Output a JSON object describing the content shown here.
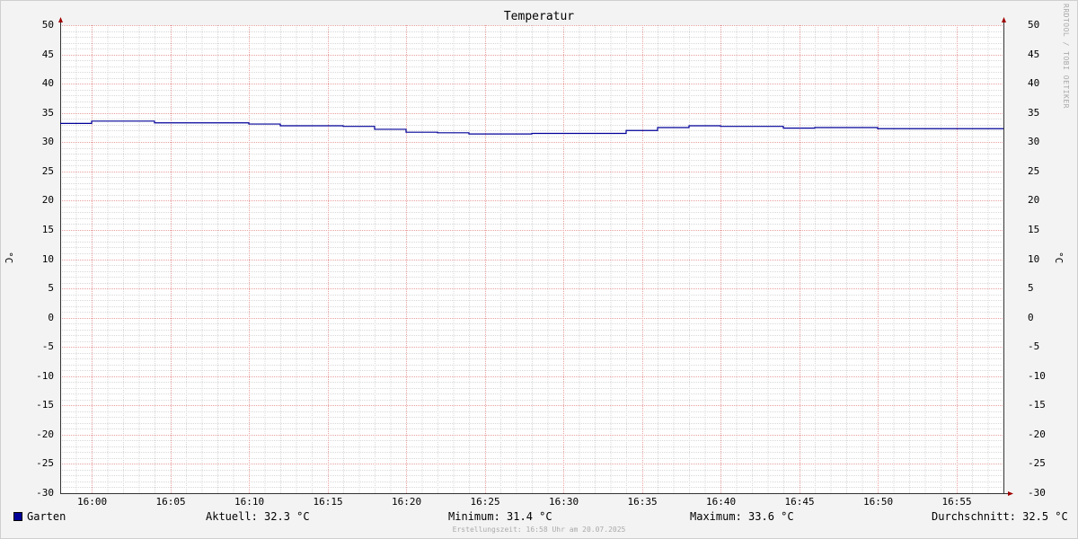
{
  "title": "Temperatur",
  "watermark": "RRDTOOL / TOBI OETIKER",
  "y_axis_label_left": "°C",
  "y_axis_label_right": "°C",
  "legend": {
    "series_name": "Garten",
    "color": "#000099",
    "current": "Aktuell: 32.3 °C",
    "minimum": "Minimum: 31.4 °C",
    "maximum": "Maximum: 33.6 °C",
    "average": "Durchschnitt: 32.5 °C"
  },
  "footer": "Erstellungszeit: 16:58 Uhr am 20.07.2025",
  "chart_data": {
    "type": "line",
    "title": "Temperatur",
    "xlabel": "",
    "ylabel": "°C",
    "ylim": [
      -30,
      50
    ],
    "xlim": [
      "15:58",
      "16:58"
    ],
    "y_ticks": [
      50,
      45,
      40,
      35,
      30,
      25,
      20,
      15,
      10,
      5,
      0,
      -5,
      -10,
      -15,
      -20,
      -25,
      -30
    ],
    "x_ticks": [
      "16:00",
      "16:05",
      "16:10",
      "16:15",
      "16:20",
      "16:25",
      "16:30",
      "16:35",
      "16:40",
      "16:45",
      "16:50",
      "16:55"
    ],
    "grid": true,
    "legend_position": "bottom-left",
    "series": [
      {
        "name": "Garten",
        "color": "#000099",
        "step": true,
        "points": [
          [
            "15:58",
            33.2
          ],
          [
            "16:00",
            33.6
          ],
          [
            "16:04",
            33.3
          ],
          [
            "16:10",
            33.1
          ],
          [
            "16:12",
            32.8
          ],
          [
            "16:16",
            32.7
          ],
          [
            "16:18",
            32.2
          ],
          [
            "16:20",
            31.7
          ],
          [
            "16:22",
            31.6
          ],
          [
            "16:24",
            31.4
          ],
          [
            "16:28",
            31.5
          ],
          [
            "16:34",
            32.0
          ],
          [
            "16:36",
            32.5
          ],
          [
            "16:38",
            32.8
          ],
          [
            "16:40",
            32.7
          ],
          [
            "16:44",
            32.4
          ],
          [
            "16:46",
            32.5
          ],
          [
            "16:50",
            32.3
          ],
          [
            "16:58",
            32.3
          ]
        ]
      }
    ]
  }
}
